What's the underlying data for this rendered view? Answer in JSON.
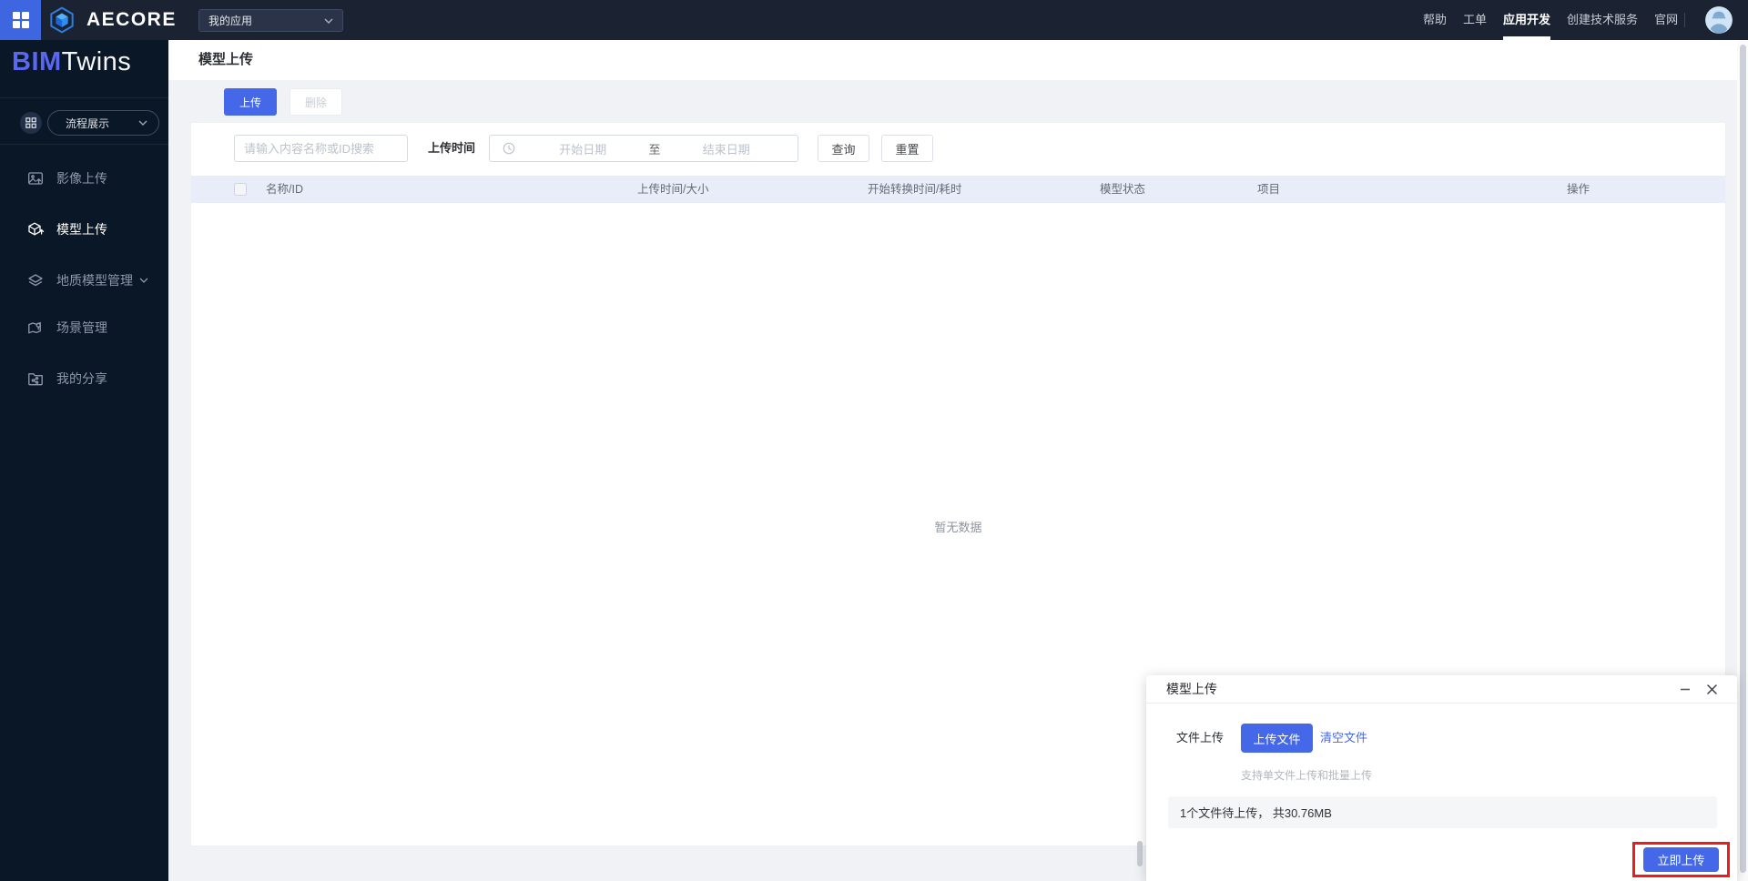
{
  "topbar": {
    "brand": "AECORE",
    "app_select": {
      "value": "我的应用"
    },
    "nav": [
      {
        "label": "帮助"
      },
      {
        "label": "工单"
      },
      {
        "label": "应用开发",
        "active": true
      },
      {
        "label": "创建技术服务"
      },
      {
        "label": "官网"
      }
    ],
    "icons": {
      "app_grid": "grid-icon",
      "avatar": "user-avatar-engineer"
    }
  },
  "sidebar": {
    "logo": {
      "bim": "BIM",
      "twins": "Twins"
    },
    "workspace_select": "流程展示",
    "items": [
      {
        "label": "影像上传",
        "icon": "image-upload-icon",
        "active": false
      },
      {
        "label": "模型上传",
        "icon": "model-upload-icon",
        "active": true
      },
      {
        "label": "地质模型管理",
        "icon": "geology-model-icon",
        "active": false,
        "has_submenu": true
      },
      {
        "label": "场景管理",
        "icon": "scene-management-icon",
        "active": false
      },
      {
        "label": "我的分享",
        "icon": "my-share-icon",
        "active": false
      }
    ]
  },
  "page": {
    "title": "模型上传",
    "toolbar": {
      "upload": "上传",
      "delete": "删除"
    },
    "filters": {
      "search_placeholder": "请输入内容名称或ID搜索",
      "upload_time_label": "上传时间",
      "start_placeholder": "开始日期",
      "range_separator": "至",
      "end_placeholder": "结束日期",
      "query": "查询",
      "reset": "重置"
    },
    "table": {
      "headers": [
        "名称/ID",
        "上传时间/大小",
        "开始转换时间/耗时",
        "模型状态",
        "项目",
        "操作"
      ],
      "rows": [],
      "empty_text": "暂无数据"
    }
  },
  "modal": {
    "title": "模型上传",
    "file_upload_label": "文件上传",
    "upload_file_button": "上传文件",
    "clear_files_button": "清空文件",
    "hint": "支持单文件上传和批量上传",
    "file_summary": "1个文件待上传， 共30.76MB",
    "submit_button": "立即上传"
  },
  "colors": {
    "primary": "#4468e8",
    "topbar_bg": "#1b2332",
    "sidebar_bg": "#0a1726",
    "logo_accent": "#5a67f0",
    "table_header_bg": "#e9edf9",
    "highlight_red": "#ec1c1c"
  }
}
